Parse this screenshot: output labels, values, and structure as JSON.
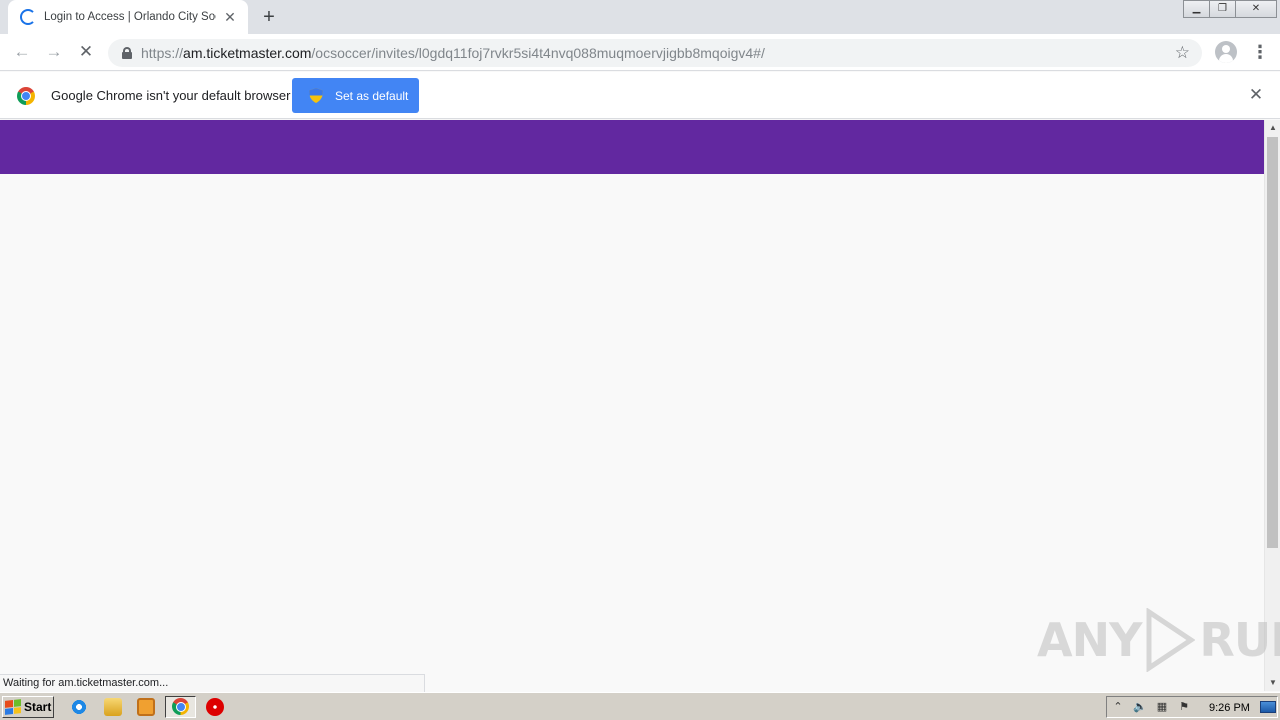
{
  "browser": {
    "tab": {
      "title": "Login to Access | Orlando City Soccer",
      "close": "✕"
    },
    "new_tab": "+",
    "window_controls": {
      "minimize": "▁",
      "restore": "❐",
      "close": "✕"
    },
    "nav": {
      "back": "←",
      "forward": "→",
      "stop": "✕"
    },
    "address": {
      "scheme": "https://",
      "host": "am.ticketmaster.com",
      "path": "/ocsoccer/invites/l0gdq11foj7rvkr5si4t4nvq088muqmoervjigbb8mqoigv4#/"
    },
    "bookmark": "☆",
    "menu": "⋮"
  },
  "infobar": {
    "message": "Google Chrome isn't your default browser",
    "button_label": "Set as default",
    "close": "✕"
  },
  "page": {
    "header_color": "#6228a0",
    "body_color": "#f9f9f9"
  },
  "status": {
    "text": "Waiting for am.ticketmaster.com..."
  },
  "watermark": {
    "left": "ANY",
    "right": "RUN"
  },
  "taskbar": {
    "start_label": "Start",
    "clock": "9:26 PM"
  },
  "icons": {
    "tab": "loading-spinner-icon",
    "lock": "lock-icon",
    "profile": "profile-icon",
    "infobar": "chrome-icon",
    "button": "uac-shield-icon"
  }
}
